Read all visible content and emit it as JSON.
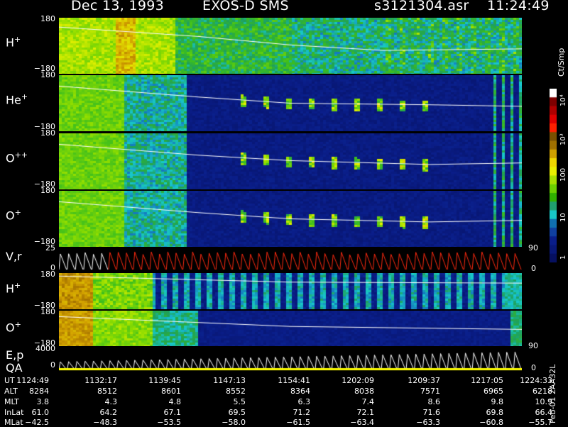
{
  "header": {
    "date": "Dec 13, 1993",
    "instrument": "EXOS-D SMS",
    "file": "s3121304.asr",
    "time": "11:24:49"
  },
  "colorbar": {
    "unit": "Ct/Smp",
    "ticks": [
      "10⁴",
      "10³",
      "100",
      "10",
      "1"
    ],
    "colors": [
      "#ffffff",
      "#7f0000",
      "#b00000",
      "#e00000",
      "#ff2000",
      "#7a5000",
      "#a07000",
      "#d0a000",
      "#f0d800",
      "#eaf000",
      "#a8e000",
      "#6cd000",
      "#30b000",
      "#20a070",
      "#18c8c8",
      "#1070b0",
      "#1040a0",
      "#0a1e8a",
      "#081878",
      "#061060"
    ]
  },
  "chart_data": [
    {
      "type": "heatmap",
      "panel": "H+",
      "label": "H",
      "label_sup": "+",
      "yticks": [
        "180",
        "−180"
      ],
      "ylim": [
        -180,
        180
      ],
      "trend": [
        [
          0,
          120
        ],
        [
          0.3,
          60
        ],
        [
          0.5,
          5
        ],
        [
          0.7,
          -30
        ],
        [
          1,
          -20
        ]
      ],
      "colormap": "counts"
    },
    {
      "type": "heatmap",
      "panel": "He+",
      "label": "He",
      "label_sup": "+",
      "yticks": [
        "180",
        "−180"
      ],
      "ylim": [
        -180,
        180
      ],
      "trend": [
        [
          0,
          110
        ],
        [
          0.3,
          40
        ],
        [
          0.5,
          0
        ],
        [
          0.8,
          -10
        ],
        [
          1,
          -20
        ]
      ],
      "colormap": "counts"
    },
    {
      "type": "heatmap",
      "panel": "O++",
      "label": "O",
      "label_sup": "++",
      "yticks": [
        "180",
        "−180"
      ],
      "ylim": [
        -180,
        180
      ],
      "trend": [
        [
          0,
          110
        ],
        [
          0.3,
          40
        ],
        [
          0.5,
          5
        ],
        [
          0.8,
          -20
        ],
        [
          1,
          -10
        ]
      ],
      "colormap": "counts"
    },
    {
      "type": "heatmap",
      "panel": "O+",
      "label": "O",
      "label_sup": "+",
      "yticks": [
        "180",
        "−180"
      ],
      "ylim": [
        -180,
        180
      ],
      "trend": [
        [
          0,
          110
        ],
        [
          0.3,
          40
        ],
        [
          0.5,
          0
        ],
        [
          0.8,
          -20
        ],
        [
          1,
          -10
        ]
      ],
      "colormap": "counts"
    },
    {
      "type": "line",
      "panel": "V,r",
      "label": "V,r",
      "yticks": [
        "25",
        "0"
      ],
      "right_ticks": [
        "90",
        "0"
      ],
      "sawtooth_periods": 56,
      "series_colors": [
        "#ffffff",
        "#ff2a10"
      ]
    },
    {
      "type": "heatmap",
      "panel": "H+ (low)",
      "label": "H",
      "label_sup": "+",
      "yticks": [
        "180",
        "−180"
      ],
      "ylim": [
        -180,
        180
      ],
      "trend": [
        [
          0,
          150
        ],
        [
          0.5,
          90
        ],
        [
          1,
          80
        ]
      ],
      "colormap": "counts"
    },
    {
      "type": "heatmap",
      "panel": "O+ (low)",
      "label": "O",
      "label_sup": "+",
      "yticks": [
        "180",
        "−180"
      ],
      "ylim": [
        -180,
        180
      ],
      "trend": [
        [
          0,
          120
        ],
        [
          0.3,
          60
        ],
        [
          0.5,
          20
        ],
        [
          1,
          -10
        ]
      ],
      "colormap": "counts"
    },
    {
      "type": "line",
      "panel": "E,p QA",
      "label": "E,p",
      "label2": "QA",
      "yticks": [
        "4000",
        "0"
      ],
      "right_ticks": [
        "90",
        "0"
      ],
      "sawtooth_periods": 56,
      "series_colors": [
        "#ffffff",
        "#ffff00"
      ]
    }
  ],
  "orbit_table": {
    "rows": [
      {
        "label": "UT",
        "values": [
          "1124:49",
          "1132:17",
          "1139:45",
          "1147:13",
          "1154:41",
          "1202:09",
          "1209:37",
          "1217:05",
          "1224:33"
        ]
      },
      {
        "label": "ALT",
        "values": [
          "8284",
          "8512",
          "8601",
          "8552",
          "8364",
          "8038",
          "7571",
          "6965",
          "6218"
        ]
      },
      {
        "label": "MLT",
        "values": [
          "3.8",
          "4.3",
          "4.8",
          "5.5",
          "6.3",
          "7.4",
          "8.6",
          "9.8",
          "10.9"
        ]
      },
      {
        "label": "InLat",
        "values": [
          "61.0",
          "64.2",
          "67.1",
          "69.5",
          "71.2",
          "72.1",
          "71.6",
          "69.8",
          "66.4"
        ]
      },
      {
        "label": "MLat",
        "values": [
          "−42.5",
          "−48.3",
          "−53.5",
          "−58.0",
          "−61.5",
          "−63.4",
          "−63.3",
          "−60.8",
          "−55.7"
        ]
      }
    ]
  },
  "footer_code": "Feb-01 2AA32L"
}
